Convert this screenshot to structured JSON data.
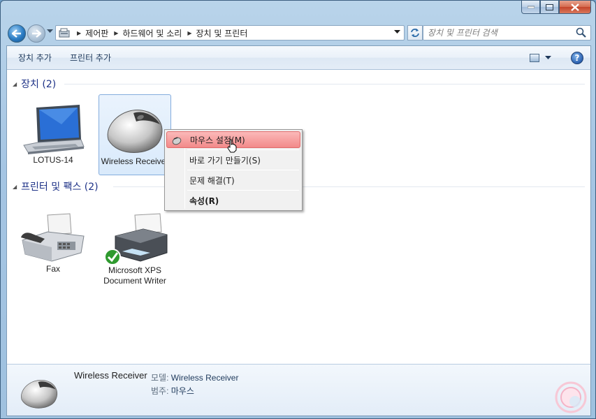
{
  "window": {
    "caption_buttons": {
      "minimize": "minimize",
      "maximize": "maximize",
      "close": "close"
    }
  },
  "nav": {
    "breadcrumb": [
      "제어판",
      "하드웨어 및 소리",
      "장치 및 프린터"
    ],
    "search_placeholder": "장치 및 프린터 검색"
  },
  "toolbar": {
    "add_device": "장치 추가",
    "add_printer": "프린터 추가",
    "help": "?"
  },
  "groups": {
    "devices": {
      "header": "장치 (2)",
      "items": [
        {
          "label": "LOTUS-14",
          "icon": "laptop-icon"
        },
        {
          "label": "Wireless Receiver",
          "icon": "mouse-icon"
        }
      ]
    },
    "printers": {
      "header": "프린터 및 팩스 (2)",
      "items": [
        {
          "label": "Fax",
          "icon": "fax-icon"
        },
        {
          "label_line1": "Microsoft XPS",
          "label_line2": "Document Writer",
          "icon": "printer-icon"
        }
      ]
    }
  },
  "context_menu": {
    "items": [
      {
        "label": "마우스 설정(M)"
      },
      {
        "label": "바로 가기 만들기(S)"
      },
      {
        "label": "문제 해결(T)"
      },
      {
        "label": "속성(R)"
      }
    ]
  },
  "details": {
    "name": "Wireless Receiver",
    "model_key": "모델:",
    "model_val": "Wireless Receiver",
    "category_key": "범주:",
    "category_val": "마우스"
  },
  "colors": {
    "accent": "#1e3287",
    "menu_highlight": "#f28a8a",
    "selection": "#d9eafb"
  }
}
